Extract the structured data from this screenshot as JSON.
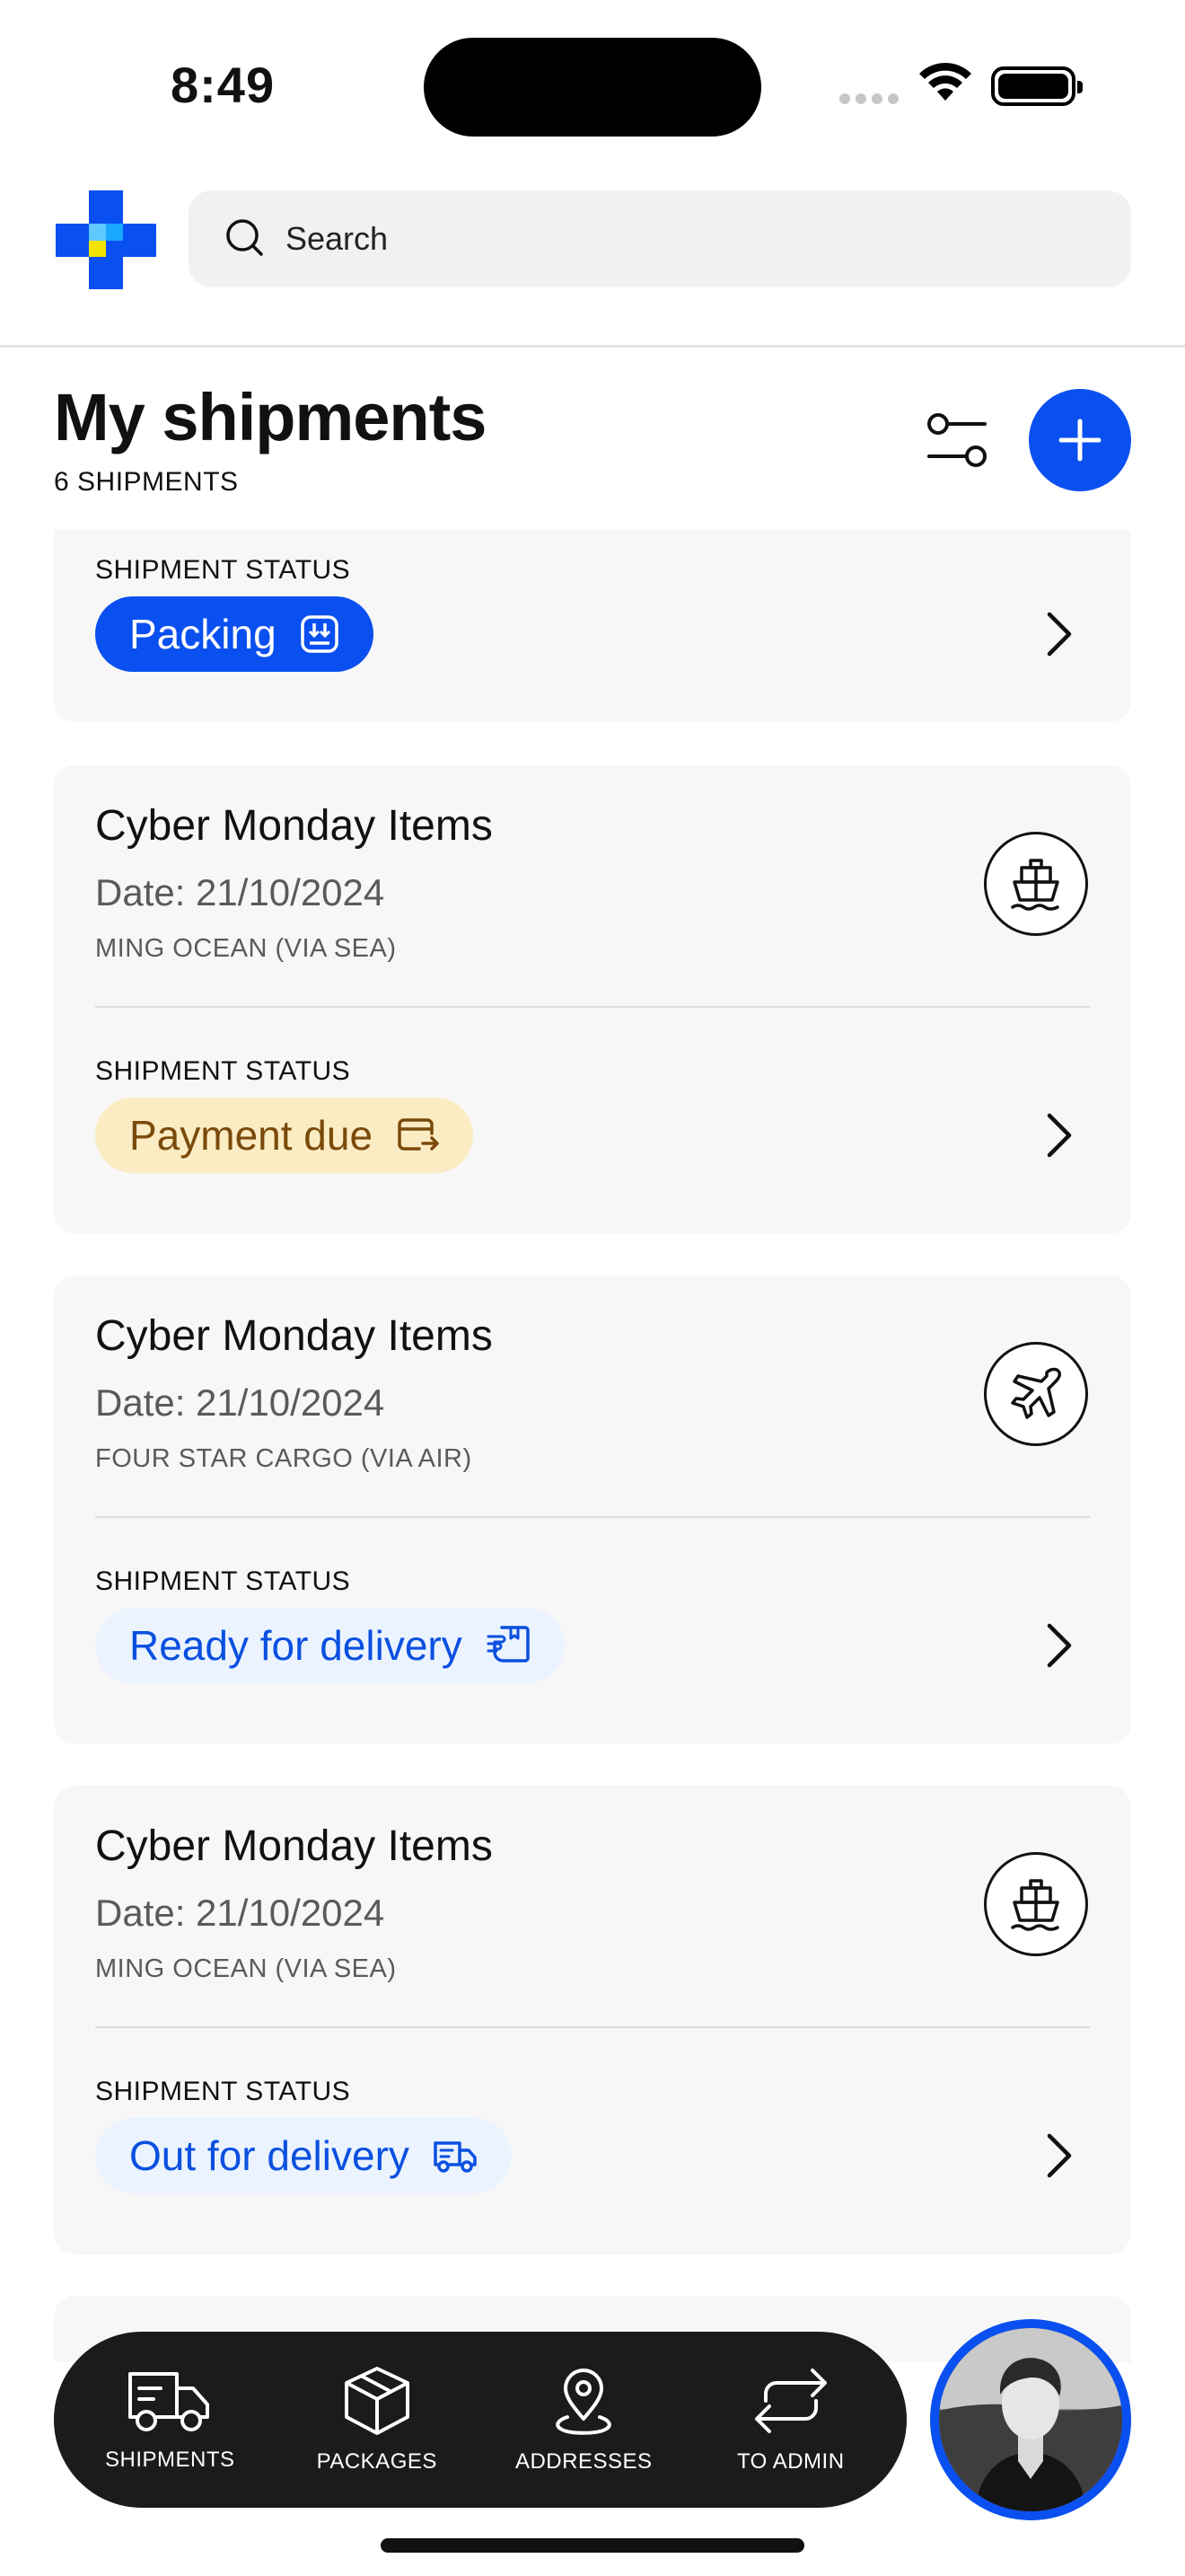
{
  "status_bar": {
    "time": "8:49"
  },
  "header": {
    "search_placeholder": "Search"
  },
  "page": {
    "title": "My shipments",
    "count": "6 SHIPMENTS"
  },
  "shipments": [
    {
      "status_label": "SHIPMENT STATUS",
      "status": "Packing"
    },
    {
      "name": "Cyber Monday Items",
      "date": "Date: 21/10/2024",
      "carrier": "MING OCEAN (VIA SEA)",
      "mode_icon": "ship-icon",
      "status_label": "SHIPMENT STATUS",
      "status": "Payment due"
    },
    {
      "name": "Cyber Monday Items",
      "date": "Date: 21/10/2024",
      "carrier": "FOUR STAR CARGO (VIA AIR)",
      "mode_icon": "plane-icon",
      "status_label": "SHIPMENT STATUS",
      "status": "Ready for delivery"
    },
    {
      "name": "Cyber Monday Items",
      "date": "Date: 21/10/2024",
      "carrier": "MING OCEAN (VIA SEA)",
      "mode_icon": "ship-icon",
      "status_label": "SHIPMENT STATUS",
      "status": "Out for delivery"
    }
  ],
  "nav": {
    "shipments": "SHIPMENTS",
    "packages": "PACKAGES",
    "addresses": "ADDRESSES",
    "to_admin": "TO ADMIN"
  },
  "colors": {
    "accent": "#0a50f0",
    "payment_bg": "#fbecc4",
    "payment_text": "#7a4a0a",
    "info_bg": "#ebf3ff"
  }
}
